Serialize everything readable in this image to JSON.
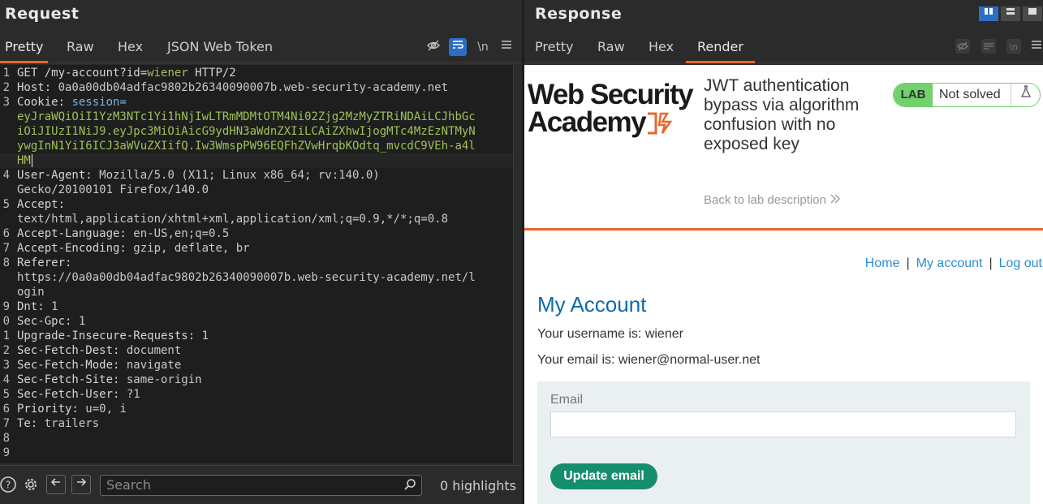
{
  "request": {
    "title": "Request",
    "tabs": [
      "Pretty",
      "Raw",
      "Hex",
      "JSON Web Token"
    ],
    "toolbar_icons": [
      "eye-slash-icon",
      "wrap-icon",
      "newline-icon",
      "menu-icon"
    ],
    "newline_label": "\\n",
    "lines": [
      {
        "n": "1",
        "parts": [
          [
            "GET /my-account?id=",
            "key"
          ],
          [
            "wiener",
            "green"
          ],
          [
            " HTTP/2",
            "key"
          ]
        ]
      },
      {
        "n": "2",
        "parts": [
          [
            "Host: ",
            "key"
          ],
          [
            "0a0a00db04adfac9802b26340090007b.web-security-academy.net",
            "val"
          ]
        ]
      },
      {
        "n": "3",
        "parts": [
          [
            "Cookie: ",
            "key"
          ],
          [
            "session=",
            "blue"
          ]
        ]
      },
      {
        "n": "",
        "parts": [
          [
            "eyJraWQiOiI1YzM3NTc1Yi1hNjIwLTRmMDMtOTM4Ni02Zjg2MzMyZTRiNDAiLCJhbGc",
            "green"
          ]
        ]
      },
      {
        "n": "",
        "parts": [
          [
            "iOiJIUzI1NiJ9.eyJpc3MiOiAicG9ydHN3aWdnZXIiLCAiZXhwIjogMTc4MzEzNTMyN",
            "green"
          ]
        ]
      },
      {
        "n": "",
        "parts": [
          [
            "ywgInN1YiI6ICJ3aWVuZXIifQ.Iw3WmspPW96EQFhZVwHrqbKOdtq_mvcdC9VEh-a4l",
            "green"
          ]
        ]
      },
      {
        "n": "",
        "parts": [
          [
            "HM",
            "green"
          ]
        ],
        "hl": true
      },
      {
        "n": "4",
        "parts": [
          [
            "User-Agent: ",
            "key"
          ],
          [
            "Mozilla/5.0 (X11; Linux x86_64; rv:140.0)",
            "val"
          ]
        ]
      },
      {
        "n": "",
        "parts": [
          [
            "Gecko/20100101 Firefox/140.0",
            "val"
          ]
        ]
      },
      {
        "n": "5",
        "parts": [
          [
            "Accept:",
            "key"
          ]
        ]
      },
      {
        "n": "",
        "parts": [
          [
            "text/html,application/xhtml+xml,application/xml;q=0.9,*/*;q=0.8",
            "val"
          ]
        ]
      },
      {
        "n": "6",
        "parts": [
          [
            "Accept-Language: ",
            "key"
          ],
          [
            "en-US,en;q=0.5",
            "val"
          ]
        ]
      },
      {
        "n": "7",
        "parts": [
          [
            "Accept-Encoding: ",
            "key"
          ],
          [
            "gzip, deflate, br",
            "val"
          ]
        ]
      },
      {
        "n": "8",
        "parts": [
          [
            "Referer:",
            "key"
          ]
        ]
      },
      {
        "n": "",
        "parts": [
          [
            "https://0a0a00db04adfac9802b26340090007b.web-security-academy.net/l",
            "val"
          ]
        ]
      },
      {
        "n": "",
        "parts": [
          [
            "ogin",
            "val"
          ]
        ]
      },
      {
        "n": "9",
        "parts": [
          [
            "Dnt: ",
            "key"
          ],
          [
            "1",
            "val"
          ]
        ]
      },
      {
        "n": "0",
        "parts": [
          [
            "Sec-Gpc: ",
            "key"
          ],
          [
            "1",
            "val"
          ]
        ]
      },
      {
        "n": "1",
        "parts": [
          [
            "Upgrade-Insecure-Requests: ",
            "key"
          ],
          [
            "1",
            "val"
          ]
        ]
      },
      {
        "n": "2",
        "parts": [
          [
            "Sec-Fetch-Dest: ",
            "key"
          ],
          [
            "document",
            "val"
          ]
        ]
      },
      {
        "n": "3",
        "parts": [
          [
            "Sec-Fetch-Mode: ",
            "key"
          ],
          [
            "navigate",
            "val"
          ]
        ]
      },
      {
        "n": "4",
        "parts": [
          [
            "Sec-Fetch-Site: ",
            "key"
          ],
          [
            "same-origin",
            "val"
          ]
        ]
      },
      {
        "n": "5",
        "parts": [
          [
            "Sec-Fetch-User: ",
            "key"
          ],
          [
            "?1",
            "val"
          ]
        ]
      },
      {
        "n": "6",
        "parts": [
          [
            "Priority: ",
            "key"
          ],
          [
            "u=0, i",
            "val"
          ]
        ]
      },
      {
        "n": "7",
        "parts": [
          [
            "Te: ",
            "key"
          ],
          [
            "trailers",
            "val"
          ]
        ]
      },
      {
        "n": "8",
        "parts": []
      },
      {
        "n": "9",
        "parts": []
      }
    ],
    "search_placeholder": "Search",
    "highlights": "0 highlights"
  },
  "response": {
    "title": "Response",
    "tabs": [
      "Pretty",
      "Raw",
      "Hex",
      "Render"
    ],
    "active_tab": "Render",
    "page": {
      "logo_line1": "Web Security",
      "logo_line2": "Academy",
      "lab_title": "JWT authentication bypass via algorithm confusion with no exposed key",
      "back_link": "Back to lab description",
      "lab_label": "LAB",
      "lab_status": "Not solved",
      "nav": [
        "Home",
        "My account",
        "Log out"
      ],
      "nav_separator": "|",
      "heading": "My Account",
      "username_line": "Your username is: wiener",
      "email_line": "Your email is: wiener@normal-user.net",
      "email_label": "Email",
      "email_value": "",
      "update_button": "Update email"
    }
  },
  "colors": {
    "accent_orange": "#e8672b",
    "active_blue": "#2b6fc2",
    "lab_green": "#70d16d",
    "button_green": "#158e6d",
    "link_blue": "#2a8ed2"
  }
}
